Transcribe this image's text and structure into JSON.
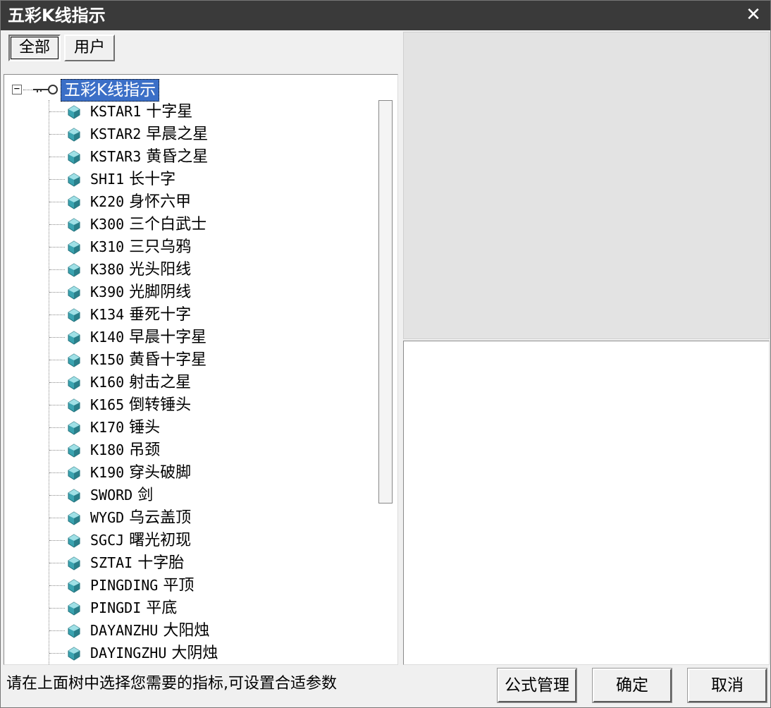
{
  "window": {
    "title": "五彩K线指示",
    "close_glyph": "✕"
  },
  "tabs": [
    {
      "label": "全部",
      "active": true
    },
    {
      "label": "用户",
      "active": false
    }
  ],
  "tree": {
    "expander_glyph": "−",
    "root_label": "五彩K线指示",
    "items": [
      {
        "code": "KSTAR1",
        "name": "十字星"
      },
      {
        "code": "KSTAR2",
        "name": "早晨之星"
      },
      {
        "code": "KSTAR3",
        "name": "黄昏之星"
      },
      {
        "code": "SHI1",
        "name": "长十字"
      },
      {
        "code": "K220",
        "name": "身怀六甲"
      },
      {
        "code": "K300",
        "name": "三个白武士"
      },
      {
        "code": "K310",
        "name": "三只乌鸦"
      },
      {
        "code": "K380",
        "name": "光头阳线"
      },
      {
        "code": "K390",
        "name": "光脚阴线"
      },
      {
        "code": "K134",
        "name": "垂死十字"
      },
      {
        "code": "K140",
        "name": "早晨十字星"
      },
      {
        "code": "K150",
        "name": "黄昏十字星"
      },
      {
        "code": "K160",
        "name": "射击之星"
      },
      {
        "code": "K165",
        "name": "倒转锤头"
      },
      {
        "code": "K170",
        "name": "锤头"
      },
      {
        "code": "K180",
        "name": "吊颈"
      },
      {
        "code": "K190",
        "name": "穿头破脚"
      },
      {
        "code": "SWORD",
        "name": "剑"
      },
      {
        "code": "WYGD",
        "name": "乌云盖顶"
      },
      {
        "code": "SGCJ",
        "name": "曙光初现"
      },
      {
        "code": "SZTAI",
        "name": "十字胎"
      },
      {
        "code": "PINGDING",
        "name": "平顶"
      },
      {
        "code": "PINGDI",
        "name": "平底"
      },
      {
        "code": "DAYANZHU",
        "name": "大阳烛"
      },
      {
        "code": "DAYINGZHU",
        "name": "大阴烛"
      }
    ]
  },
  "status": {
    "hint": "请在上面树中选择您需要的指标,可设置合适参数"
  },
  "buttons": {
    "formula": "公式管理",
    "ok": "确定",
    "cancel": "取消"
  },
  "colors": {
    "titlebar": "#3a3a3a",
    "selection": "#3b6fc7",
    "leaf_icon": "#3aa3b0"
  },
  "icons": {
    "root": "key-icon",
    "leaf": "indicator-gem-icon",
    "close": "close-icon"
  }
}
